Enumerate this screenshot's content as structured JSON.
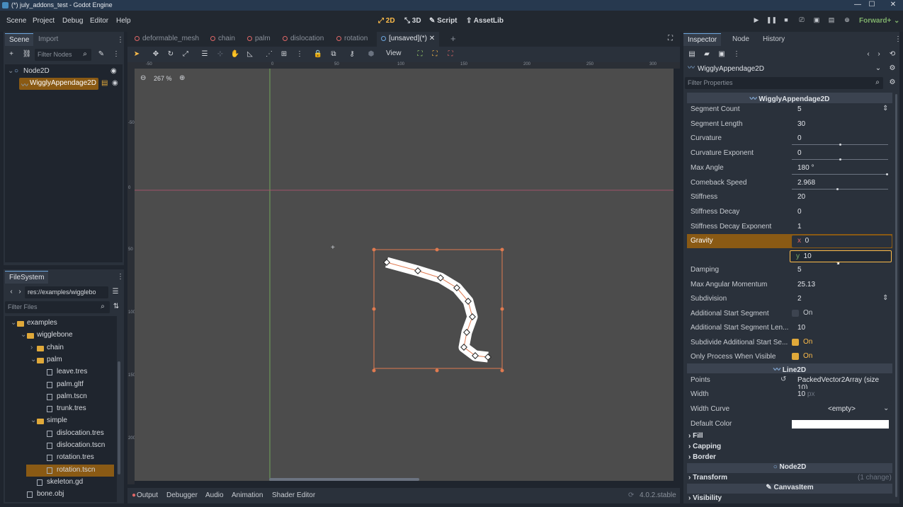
{
  "window": {
    "title": "(*) july_addons_test - Godot Engine",
    "min": "—",
    "max": "☐",
    "close": "✕"
  },
  "menu": [
    "Scene",
    "Project",
    "Debug",
    "Editor",
    "Help"
  ],
  "workspaces": [
    {
      "label": "2D",
      "active": true
    },
    {
      "label": "3D"
    },
    {
      "label": "Script"
    },
    {
      "label": "AssetLib"
    }
  ],
  "renderer": "Forward+",
  "scene_dock": {
    "tabs": [
      "Scene",
      "Import"
    ],
    "filter_placeholder": "Filter Nodes",
    "nodes": [
      {
        "label": "Node2D"
      },
      {
        "label": "WigglyAppendage2D",
        "selected": true
      }
    ]
  },
  "filesystem": {
    "tab": "FileSystem",
    "path": "res://examples/wigglebo",
    "filter_placeholder": "Filter Files",
    "items": [
      {
        "label": "examples",
        "type": "folder",
        "depth": 0
      },
      {
        "label": "wigglebone",
        "type": "folder",
        "depth": 1
      },
      {
        "label": "chain",
        "type": "folder",
        "depth": 2
      },
      {
        "label": "palm",
        "type": "folder",
        "depth": 2
      },
      {
        "label": "leave.tres",
        "type": "file",
        "depth": 3
      },
      {
        "label": "palm.gltf",
        "type": "file",
        "depth": 3
      },
      {
        "label": "palm.tscn",
        "type": "file",
        "depth": 3
      },
      {
        "label": "trunk.tres",
        "type": "file",
        "depth": 3
      },
      {
        "label": "simple",
        "type": "folder",
        "depth": 2
      },
      {
        "label": "dislocation.tres",
        "type": "file",
        "depth": 3
      },
      {
        "label": "dislocation.tscn",
        "type": "file",
        "depth": 3
      },
      {
        "label": "rotation.tres",
        "type": "file",
        "depth": 3
      },
      {
        "label": "rotation.tscn",
        "type": "file",
        "depth": 3,
        "selected": true
      },
      {
        "label": "skeleton.gd",
        "type": "file",
        "depth": 2
      },
      {
        "label": "bone.obj",
        "type": "file",
        "depth": 1
      }
    ]
  },
  "editor_tabs": [
    {
      "label": "deformable_mesh"
    },
    {
      "label": "chain"
    },
    {
      "label": "palm"
    },
    {
      "label": "dislocation"
    },
    {
      "label": "rotation"
    },
    {
      "label": "[unsaved](*)",
      "active": true
    }
  ],
  "toolbar": {
    "view_label": "View"
  },
  "viewport": {
    "zoom": "267 %",
    "ruler_ticks": [
      "-50",
      "0",
      "50",
      "100",
      "150",
      "200",
      "250",
      "300"
    ],
    "ruler_v_ticks": [
      "-50",
      "0",
      "50",
      "100",
      "150",
      "200"
    ]
  },
  "bottom_panel": [
    "Output",
    "Debugger",
    "Audio",
    "Animation",
    "Shader Editor"
  ],
  "version": "4.0.2.stable",
  "inspector": {
    "tabs": [
      "Inspector",
      "Node",
      "History"
    ],
    "object": "WigglyAppendage2D",
    "filter_placeholder": "Filter Properties",
    "section_main": "WigglyAppendage2D",
    "props": [
      {
        "key": "Segment Count",
        "value": "5"
      },
      {
        "key": "Segment Length",
        "value": "30"
      },
      {
        "key": "Curvature",
        "value": "0"
      },
      {
        "key": "Curvature Exponent",
        "value": "0"
      },
      {
        "key": "Max Angle",
        "value": "180 °"
      },
      {
        "key": "Comeback Speed",
        "value": "2.968"
      },
      {
        "key": "Stiffness",
        "value": "20"
      },
      {
        "key": "Stiffness Decay",
        "value": "0"
      },
      {
        "key": "Stiffness Decay Exponent",
        "value": "1"
      }
    ],
    "gravity": {
      "key": "Gravity",
      "x": "0",
      "y": "10",
      "x_label": "x",
      "y_label": "y"
    },
    "props2": [
      {
        "key": "Damping",
        "value": "5"
      },
      {
        "key": "Max Angular Momentum",
        "value": "25.13"
      },
      {
        "key": "Subdivision",
        "value": "2"
      }
    ],
    "checks": [
      {
        "key": "Additional Start Segment",
        "label": "On",
        "checked": false
      },
      {
        "key": "Additional Start Segment Len...",
        "value": "10"
      },
      {
        "key": "Subdivide Additional Start Se...",
        "label": "On",
        "checked": true
      },
      {
        "key": "Only Process When Visible",
        "label": "On",
        "checked": true
      }
    ],
    "section_line": "Line2D",
    "points": {
      "key": "Points",
      "value": "PackedVector2Array (size 10)"
    },
    "width": {
      "key": "Width",
      "value": "10",
      "unit": "px"
    },
    "width_curve": {
      "key": "Width Curve",
      "value": "<empty>"
    },
    "default_color": {
      "key": "Default Color",
      "color": "#ffffff"
    },
    "groups": [
      "Fill",
      "Capping",
      "Border"
    ],
    "section_node2d": "Node2D",
    "transform": {
      "key": "Transform",
      "note": "(1 change)"
    },
    "section_canvas": "CanvasItem",
    "visibility": "Visibility"
  },
  "colors": {
    "accent": "#ffbd4a",
    "selection": "#8a5a14",
    "bone_line": "#e07a50"
  }
}
